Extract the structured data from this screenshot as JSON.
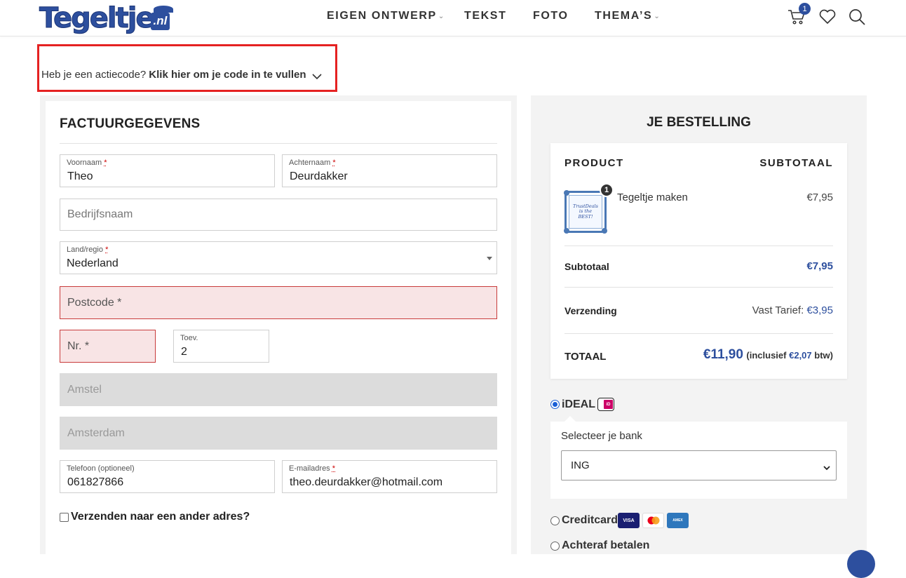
{
  "header": {
    "logo": {
      "main": "Tegeltje",
      "suffix": ".nl"
    },
    "nav": [
      {
        "label": "EIGEN ONTWERP",
        "has_dropdown": true
      },
      {
        "label": "TEKST",
        "has_dropdown": false
      },
      {
        "label": "FOTO",
        "has_dropdown": false
      },
      {
        "label": "THEMA’S",
        "has_dropdown": true
      }
    ],
    "cart_count": "1",
    "icons": [
      "cart-icon",
      "heart-icon",
      "search-icon"
    ]
  },
  "coupon": {
    "question": "Heb je een actiecode?",
    "link": "Klik hier om je code in te vullen"
  },
  "billing": {
    "title": "FACTUURGEGEVENS",
    "first_name": {
      "label": "Voornaam",
      "required": "*",
      "value": "Theo"
    },
    "last_name": {
      "label": "Achternaam",
      "required": "*",
      "value": "Deurdakker"
    },
    "company": {
      "placeholder": "Bedrijfsnaam"
    },
    "country": {
      "label": "Land/regio",
      "required": "*",
      "value": "Nederland"
    },
    "postcode": {
      "placeholder": "Postcode *"
    },
    "house_number": {
      "placeholder": "Nr. *"
    },
    "addition": {
      "label": "Toev.",
      "value": "2"
    },
    "street": {
      "placeholder": "Amstel"
    },
    "city": {
      "placeholder": "Amsterdam"
    },
    "phone": {
      "label": "Telefoon (optioneel)",
      "value": "061827866"
    },
    "email": {
      "label": "E-mailadres",
      "required": "*",
      "value": "theo.deurdakker@hotmail.com"
    },
    "ship_different": "Verzenden naar een ander adres?"
  },
  "order": {
    "title": "JE BESTELLING",
    "col_product": "PRODUCT",
    "col_subtotal": "SUBTOTAAL",
    "item": {
      "name": "Tegeltje maken",
      "price": "€7,95",
      "qty": "1",
      "tile_text": [
        "TrustDeals",
        "is the",
        "BEST!"
      ]
    },
    "subtotal_label": "Subtotaal",
    "subtotal_value": "€7,95",
    "shipping_label": "Verzending",
    "shipping_prefix": "Vast Tarief:",
    "shipping_value": "€3,95",
    "total_label": "TOTAAL",
    "total_value": "€11,90",
    "tax_prefix": "(inclusief",
    "tax_value": "€2,07",
    "tax_suffix": "btw)"
  },
  "payment": {
    "ideal_label": "iDEAL",
    "bank_label": "Selecteer je bank",
    "bank_value": "ING",
    "creditcard_label": "Creditcard",
    "afterpay_label": "Achteraf betalen",
    "card_brands": [
      "VISA",
      "mastercard",
      "AMERICAN EXPRESS"
    ]
  },
  "colors": {
    "brand_blue": "#2d4f9e",
    "error_border": "#c83b3b",
    "error_bg": "#f8e4e5",
    "highlight_red": "#e52222"
  }
}
